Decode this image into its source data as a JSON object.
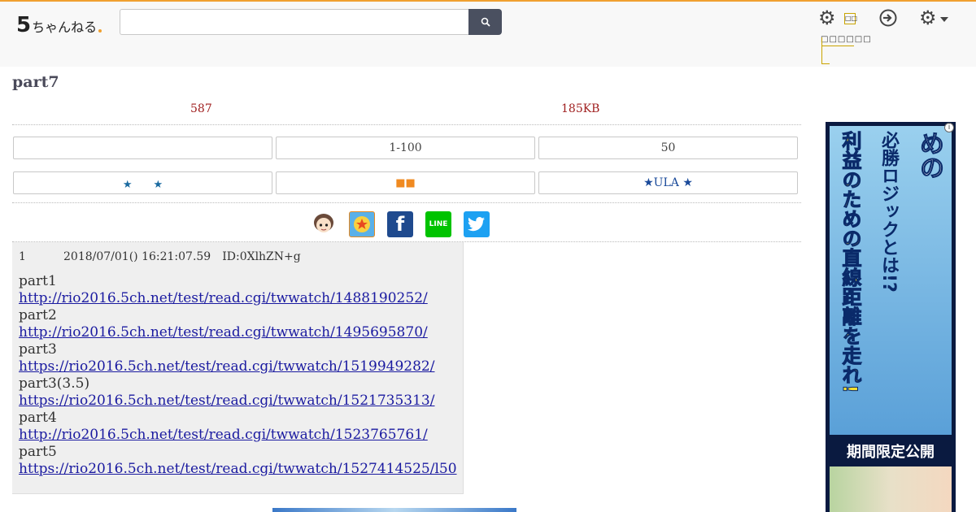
{
  "header": {
    "logo_big": "5",
    "logo_small": "ちゃんねる",
    "search_value": "",
    "search_placeholder": "",
    "menu_label": "□□",
    "menu_tree_label": "□□□□□□"
  },
  "thread": {
    "title": "part7",
    "post_count": "587",
    "size": "185KB"
  },
  "nav": {
    "row1": [
      "",
      "1-100",
      "50"
    ],
    "row2_left": "★　　★",
    "row2_mid": "■■",
    "row2_right": "★ULA ★"
  },
  "social": {
    "facebook": "f",
    "line": "LINE",
    "twitter": "🐦"
  },
  "post": {
    "number": "1",
    "date": "2018/07/01() 16:21:07.59",
    "id": "ID:0XlhZN+g",
    "lines": [
      {
        "label": "part1",
        "url": "http://rio2016.5ch.net/test/read.cgi/twwatch/1488190252/"
      },
      {
        "label": "part2",
        "url": "http://rio2016.5ch.net/test/read.cgi/twwatch/1495695870/"
      },
      {
        "label": "part3",
        "url": "https://rio2016.5ch.net/test/read.cgi/twwatch/1519949282/"
      },
      {
        "label": "part3(3.5)",
        "url": "https://rio2016.5ch.net/test/read.cgi/twwatch/1521735313/"
      },
      {
        "label": "part4",
        "url": "http://rio2016.5ch.net/test/read.cgi/twwatch/1523765761/"
      },
      {
        "label": "part5",
        "url": "https://rio2016.5ch.net/test/read.cgi/twwatch/1527414525/l50"
      }
    ]
  },
  "ad": {
    "text1": "バイナリーで勝ち続けるための",
    "text2": "必勝ロジックとは!?",
    "text3": "利益のための直線距離を走れ!",
    "band": "期間限定公開",
    "info": "i"
  },
  "colors": {
    "accent": "#f0a030",
    "meta_red": "#a02020",
    "link": "#1a1aa0"
  }
}
